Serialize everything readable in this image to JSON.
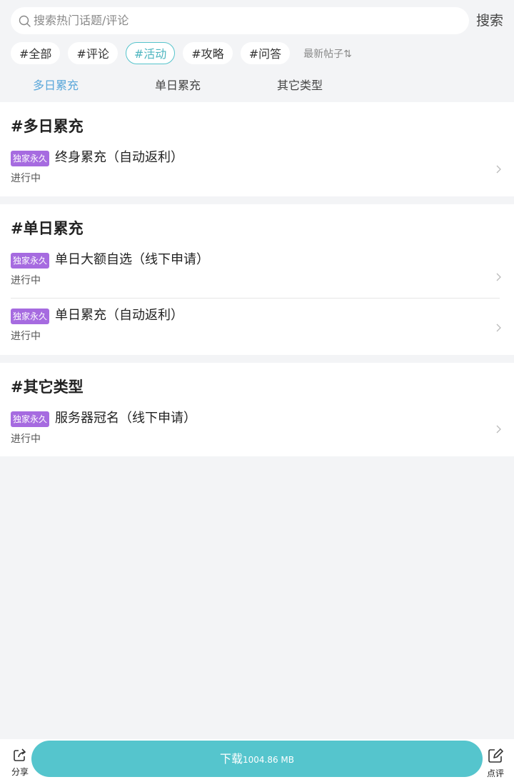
{
  "search": {
    "placeholder": "搜索热门话题/评论",
    "button_label": "搜索"
  },
  "tags": [
    "#全部",
    "#评论",
    "#活动",
    "#攻略",
    "#问答"
  ],
  "active_tag": "#活动",
  "sort_label": "最新帖子",
  "subtabs": [
    "多日累充",
    "单日累充",
    "其它类型"
  ],
  "active_subtab": "多日累充",
  "sections": [
    {
      "title": "#多日累充",
      "items": [
        {
          "badge": "独家永久",
          "title": "终身累充（自动返利）",
          "status": "进行中"
        }
      ]
    },
    {
      "title": "#单日累充",
      "items": [
        {
          "badge": "独家永久",
          "title": "单日大额自选（线下申请）",
          "status": "进行中"
        },
        {
          "badge": "独家永久",
          "title": "单日累充（自动返利）",
          "status": "进行中"
        }
      ]
    },
    {
      "title": "#其它类型",
      "items": [
        {
          "badge": "独家永久",
          "title": "服务器冠名（线下申请）",
          "status": "进行中"
        }
      ]
    }
  ],
  "bottom": {
    "share_label": "分享",
    "download_label": "下载",
    "download_size": "1004.86 MB",
    "review_label": "点评"
  },
  "colors": {
    "accent": "#55c5cd",
    "subtab_active": "#5aa7da",
    "badge": "#a66be0",
    "background": "#f3f4f6"
  }
}
